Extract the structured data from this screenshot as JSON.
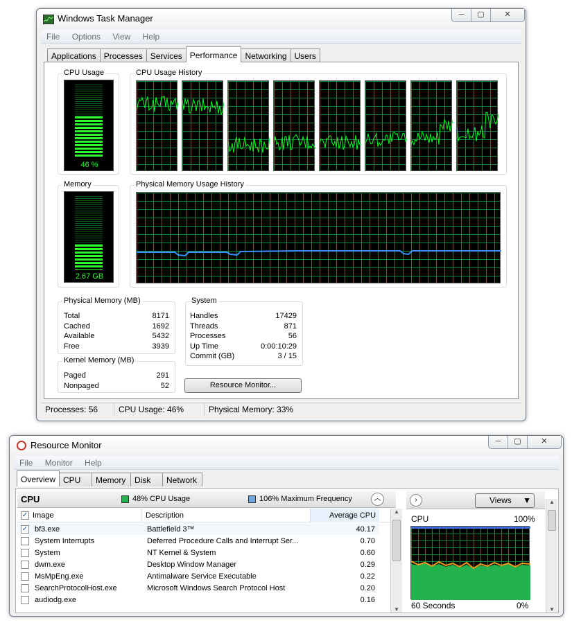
{
  "task_manager": {
    "title": "Windows Task Manager",
    "menu": [
      "File",
      "Options",
      "View",
      "Help"
    ],
    "tabs": [
      "Applications",
      "Processes",
      "Services",
      "Performance",
      "Networking",
      "Users"
    ],
    "active_tab": "Performance",
    "cpu_usage": {
      "label": "CPU Usage",
      "value": "46 %",
      "percent": 46
    },
    "cpu_history": {
      "label": "CPU Usage History",
      "cores": 8
    },
    "memory": {
      "label": "Memory",
      "value": "2.67 GB",
      "percent": 33
    },
    "memory_history": {
      "label": "Physical Memory Usage History"
    },
    "physical_memory": {
      "label": "Physical Memory (MB)",
      "rows": [
        {
          "k": "Total",
          "v": "8171"
        },
        {
          "k": "Cached",
          "v": "1692"
        },
        {
          "k": "Available",
          "v": "5432"
        },
        {
          "k": "Free",
          "v": "3939"
        }
      ]
    },
    "kernel_memory": {
      "label": "Kernel Memory (MB)",
      "rows": [
        {
          "k": "Paged",
          "v": "291"
        },
        {
          "k": "Nonpaged",
          "v": "52"
        }
      ]
    },
    "system": {
      "label": "System",
      "rows": [
        {
          "k": "Handles",
          "v": "17429"
        },
        {
          "k": "Threads",
          "v": "871"
        },
        {
          "k": "Processes",
          "v": "56"
        },
        {
          "k": "Up Time",
          "v": "0:00:10:29"
        },
        {
          "k": "Commit (GB)",
          "v": "3 / 15"
        }
      ]
    },
    "resource_monitor_button": "Resource Monitor...",
    "status": [
      "Processes: 56",
      "CPU Usage: 46%",
      "Physical Memory: 33%"
    ]
  },
  "resource_monitor": {
    "title": "Resource Monitor",
    "menu": [
      "File",
      "Monitor",
      "Help"
    ],
    "tabs": [
      "Overview",
      "CPU",
      "Memory",
      "Disk",
      "Network"
    ],
    "active_tab": "Overview",
    "cpu_section": {
      "label": "CPU",
      "usage": "48% CPU Usage",
      "frequency": "106% Maximum Frequency",
      "usage_color": "#22b14c",
      "frequency_color": "#6ea6dd"
    },
    "columns": [
      "Image",
      "Description",
      "Average CPU"
    ],
    "processes": [
      {
        "image": "bf3.exe",
        "description": "Battlefield 3™",
        "cpu": "40.17",
        "checked": true
      },
      {
        "image": "System Interrupts",
        "description": "Deferred Procedure Calls and Interrupt Ser...",
        "cpu": "0.70",
        "checked": false
      },
      {
        "image": "System",
        "description": "NT Kernel & System",
        "cpu": "0.60",
        "checked": false
      },
      {
        "image": "dwm.exe",
        "description": "Desktop Window Manager",
        "cpu": "0.29",
        "checked": false
      },
      {
        "image": "MsMpEng.exe",
        "description": "Antimalware Service Executable",
        "cpu": "0.22",
        "checked": false
      },
      {
        "image": "SearchProtocolHost.exe",
        "description": "Microsoft Windows Search Protocol Host",
        "cpu": "0.20",
        "checked": false
      },
      {
        "image": "audiodg.exe",
        "description": "",
        "cpu": "0.16",
        "checked": false
      }
    ],
    "graph": {
      "label": "CPU",
      "max": "100%",
      "time": "60 Seconds",
      "min": "0%"
    },
    "views_button": "Views"
  },
  "colors": {
    "graph_green": "#00ff21",
    "grid": "#0b8a3b",
    "memory_line": "#3f8fff",
    "orange": "#f39a1e"
  }
}
